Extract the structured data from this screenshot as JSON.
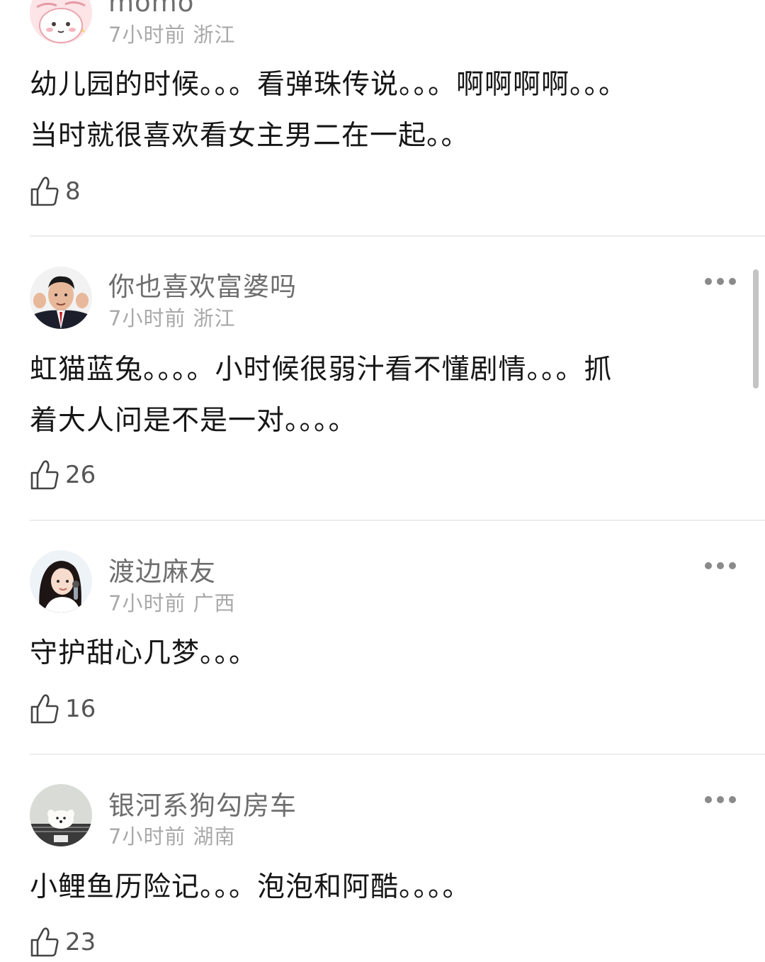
{
  "comments": [
    {
      "username": "momo",
      "time": "7小时前",
      "location": "浙江",
      "text": "幼儿园的时候。。。看弹珠传说。。。啊啊啊啊。。。\n当时就很喜欢看女主男二在一起。。",
      "likes": "8"
    },
    {
      "username": "你也喜欢富婆吗",
      "time": "7小时前",
      "location": "浙江",
      "text": "虹猫蓝兔。。。。小时候很弱汁看不懂剧情。。。抓\n着大人问是不是一对。。。。",
      "likes": "26"
    },
    {
      "username": "渡边麻友",
      "time": "7小时前",
      "location": "广西",
      "text": "守护甜心几梦。。。",
      "likes": "16"
    },
    {
      "username": "银河系狗勾房车",
      "time": "7小时前",
      "location": "湖南",
      "text": "小鲤鱼历险记。。。泡泡和阿酷。。。。",
      "likes": "23"
    }
  ],
  "icons": {
    "more": "more-dots-icon",
    "like": "thumbs-up-icon"
  },
  "colors": {
    "username": "#6e6e6e",
    "meta": "#a9a9a9",
    "body": "#161616",
    "divider": "#ececec"
  }
}
